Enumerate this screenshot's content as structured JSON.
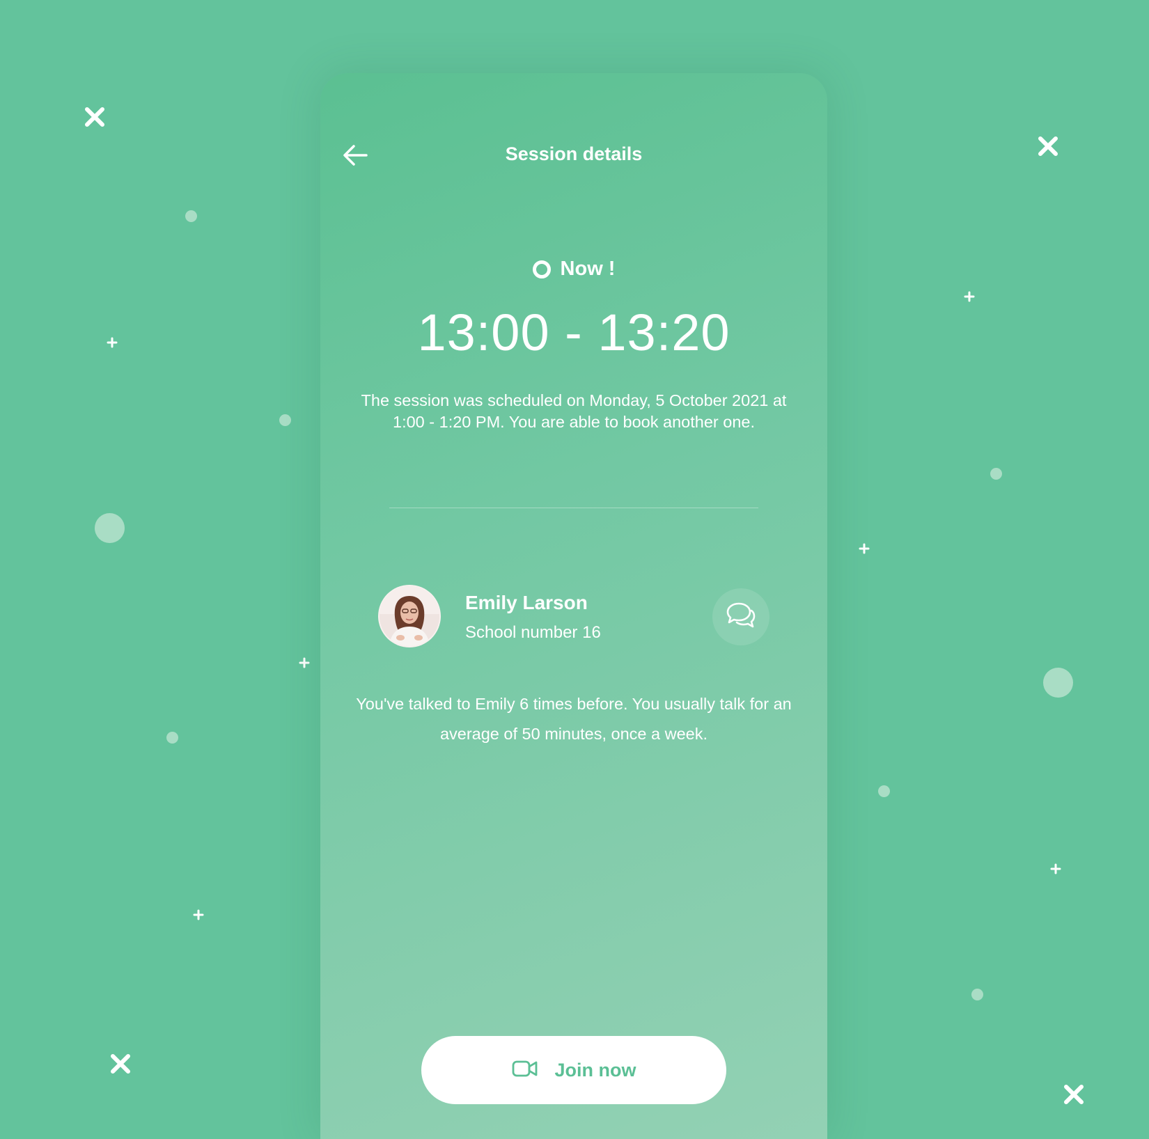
{
  "header": {
    "title": "Session details",
    "back_icon": "arrow-left-icon"
  },
  "session": {
    "status_label": "Now !",
    "time_range": "13:00 - 13:20",
    "schedule_text": "The session was scheduled on Monday, 5 October 2021 at 1:00 - 1:20 PM. You are able to book another one."
  },
  "contact": {
    "name": "Emily Larson",
    "school": "School number 16",
    "chat_icon": "chat-bubbles-icon",
    "history_text": "You've talked to Emily 6 times before. You usually talk for an average of 50 minutes, once a week."
  },
  "actions": {
    "join_label": "Join now",
    "join_icon": "video-camera-icon"
  },
  "colors": {
    "background": "#63c39c",
    "accent": "#5bbf95",
    "text": "#ffffff"
  }
}
